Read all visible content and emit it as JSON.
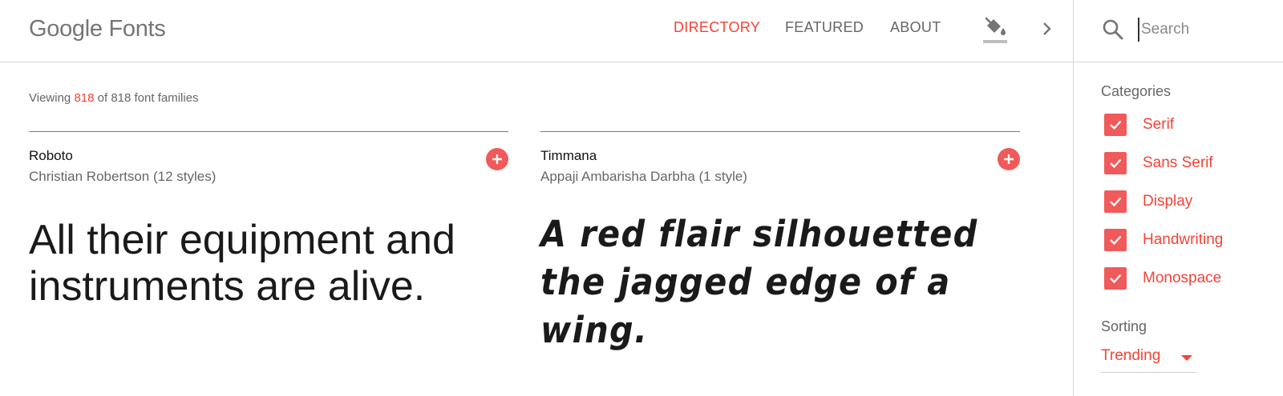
{
  "header": {
    "logo": "Google Fonts",
    "nav": [
      {
        "label": "DIRECTORY",
        "active": true
      },
      {
        "label": "FEATURED",
        "active": false
      },
      {
        "label": "ABOUT",
        "active": false
      }
    ],
    "icons": [
      "paint-bucket-icon",
      "chevron-right-icon"
    ]
  },
  "search": {
    "placeholder": "Search",
    "value": ""
  },
  "viewing": {
    "prefix": "Viewing",
    "shown": "818",
    "middle": "of 818 font families"
  },
  "cards": [
    {
      "name": "Roboto",
      "author": "Christian Robertson (12 styles)",
      "sample": "All their equipment and instruments are alive."
    },
    {
      "name": "Timmana",
      "author": "Appaji Ambarisha Darbha (1 style)",
      "sample": "A red flair silhouetted the jagged edge of a wing."
    }
  ],
  "sidebar": {
    "categories_label": "Categories",
    "categories": [
      {
        "label": "Serif",
        "checked": true
      },
      {
        "label": "Sans Serif",
        "checked": true
      },
      {
        "label": "Display",
        "checked": true
      },
      {
        "label": "Handwriting",
        "checked": true
      },
      {
        "label": "Monospace",
        "checked": true
      }
    ],
    "sorting_label": "Sorting",
    "sorting_value": "Trending"
  },
  "colors": {
    "accent": "#f44336",
    "checkbox": "#f05a5a",
    "text_muted": "#666666"
  }
}
